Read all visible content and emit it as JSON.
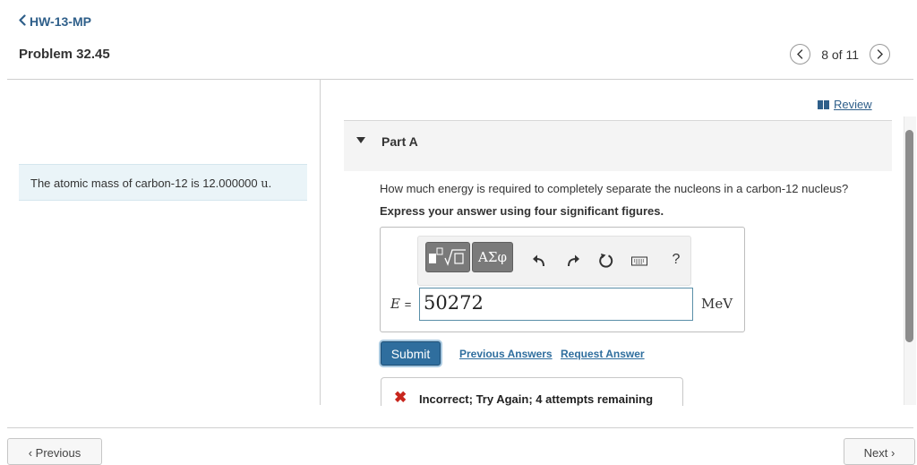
{
  "header": {
    "back_label": "HW-13-MP",
    "problem_title": "Problem 32.45",
    "pager_text": "8 of 11"
  },
  "left_panel": {
    "info_text": "The atomic mass of carbon-12 is 12.000000",
    "info_unit": "u",
    "info_end": "."
  },
  "right_panel": {
    "review_label": "Review",
    "part_label": "Part A",
    "question": "How much energy is required to completely separate the nucleons in a carbon-12 nucleus?",
    "instruction": "Express your answer using four significant figures.",
    "toolbar": {
      "greek_label": "ΑΣφ",
      "help_label": "?"
    },
    "equation_variable": "E",
    "equation_equals": "=",
    "answer_value": "50272",
    "unit": "MeV",
    "submit_label": "Submit",
    "previous_answers_label": "Previous Answers",
    "request_answer_label": "Request Answer",
    "feedback_text": "Incorrect; Try Again; 4 attempts remaining",
    "feedback_symbol": "✖"
  },
  "footer": {
    "previous_label": "‹ Previous",
    "next_label": "Next ›"
  },
  "colors": {
    "accent": "#2f6e9e",
    "link": "#2f5f8a",
    "error": "#c8261d",
    "info_bg": "#eaf4f8"
  }
}
